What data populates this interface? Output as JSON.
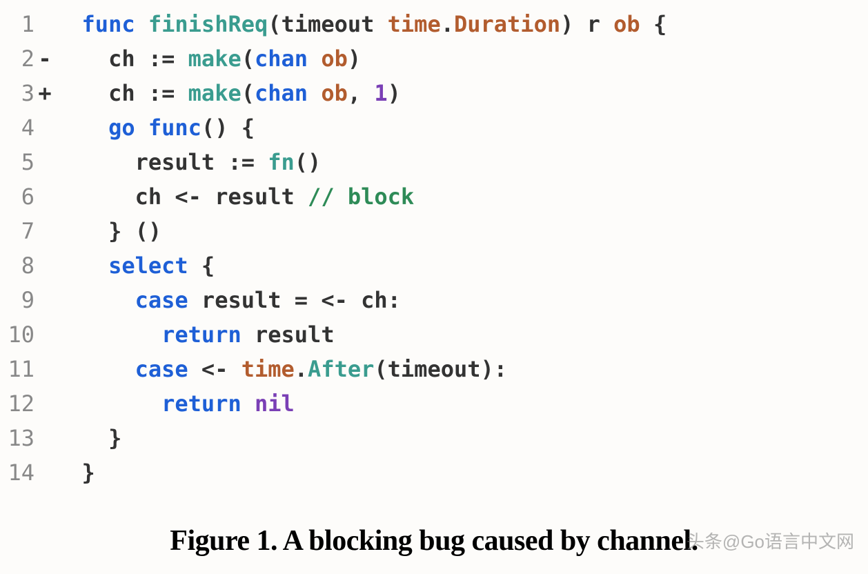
{
  "code": {
    "lines": [
      {
        "n": "1",
        "diff": "",
        "indent": 1,
        "tokens": [
          {
            "t": "func ",
            "c": "kw"
          },
          {
            "t": "finishReq",
            "c": "fn"
          },
          {
            "t": "(",
            "c": "punc"
          },
          {
            "t": "timeout ",
            "c": "id"
          },
          {
            "t": "time",
            "c": "ty"
          },
          {
            "t": ".",
            "c": "punc"
          },
          {
            "t": "Duration",
            "c": "ty"
          },
          {
            "t": ") ",
            "c": "punc"
          },
          {
            "t": "r ",
            "c": "id"
          },
          {
            "t": "ob ",
            "c": "ty"
          },
          {
            "t": "{",
            "c": "punc"
          }
        ]
      },
      {
        "n": "2",
        "diff": "-",
        "indent": 2,
        "tokens": [
          {
            "t": "ch ",
            "c": "id"
          },
          {
            "t": ":= ",
            "c": "punc"
          },
          {
            "t": "make",
            "c": "fn"
          },
          {
            "t": "(",
            "c": "punc"
          },
          {
            "t": "chan ",
            "c": "kw"
          },
          {
            "t": "ob",
            "c": "ty"
          },
          {
            "t": ")",
            "c": "punc"
          }
        ]
      },
      {
        "n": "3",
        "diff": "+",
        "indent": 2,
        "tokens": [
          {
            "t": "ch ",
            "c": "id"
          },
          {
            "t": ":= ",
            "c": "punc"
          },
          {
            "t": "make",
            "c": "fn"
          },
          {
            "t": "(",
            "c": "punc"
          },
          {
            "t": "chan ",
            "c": "kw"
          },
          {
            "t": "ob",
            "c": "ty"
          },
          {
            "t": ", ",
            "c": "punc"
          },
          {
            "t": "1",
            "c": "num"
          },
          {
            "t": ")",
            "c": "punc"
          }
        ]
      },
      {
        "n": "4",
        "diff": "",
        "indent": 2,
        "tokens": [
          {
            "t": "go ",
            "c": "kw"
          },
          {
            "t": "func",
            "c": "kw"
          },
          {
            "t": "() {",
            "c": "punc"
          }
        ]
      },
      {
        "n": "5",
        "diff": "",
        "indent": 3,
        "tokens": [
          {
            "t": "result ",
            "c": "id"
          },
          {
            "t": ":= ",
            "c": "punc"
          },
          {
            "t": "fn",
            "c": "fn"
          },
          {
            "t": "()",
            "c": "punc"
          }
        ]
      },
      {
        "n": "6",
        "diff": "",
        "indent": 3,
        "tokens": [
          {
            "t": "ch ",
            "c": "id"
          },
          {
            "t": "<- ",
            "c": "punc"
          },
          {
            "t": "result ",
            "c": "id"
          },
          {
            "t": "// block",
            "c": "cm"
          }
        ]
      },
      {
        "n": "7",
        "diff": "",
        "indent": 2,
        "tokens": [
          {
            "t": "} ()",
            "c": "punc"
          }
        ]
      },
      {
        "n": "8",
        "diff": "",
        "indent": 2,
        "tokens": [
          {
            "t": "select ",
            "c": "kw"
          },
          {
            "t": "{",
            "c": "punc"
          }
        ]
      },
      {
        "n": "9",
        "diff": "",
        "indent": 3,
        "tokens": [
          {
            "t": "case ",
            "c": "kw"
          },
          {
            "t": "result ",
            "c": "id"
          },
          {
            "t": "= <- ",
            "c": "punc"
          },
          {
            "t": "ch",
            "c": "id"
          },
          {
            "t": ":",
            "c": "punc"
          }
        ]
      },
      {
        "n": "10",
        "diff": "",
        "indent": 4,
        "tokens": [
          {
            "t": "return ",
            "c": "kw"
          },
          {
            "t": "result",
            "c": "id"
          }
        ]
      },
      {
        "n": "11",
        "diff": "",
        "indent": 3,
        "tokens": [
          {
            "t": "case ",
            "c": "kw"
          },
          {
            "t": "<- ",
            "c": "punc"
          },
          {
            "t": "time",
            "c": "ty"
          },
          {
            "t": ".",
            "c": "punc"
          },
          {
            "t": "After",
            "c": "fn"
          },
          {
            "t": "(",
            "c": "punc"
          },
          {
            "t": "timeout",
            "c": "id"
          },
          {
            "t": "):",
            "c": "punc"
          }
        ]
      },
      {
        "n": "12",
        "diff": "",
        "indent": 4,
        "tokens": [
          {
            "t": "return ",
            "c": "kw"
          },
          {
            "t": "nil",
            "c": "num"
          }
        ]
      },
      {
        "n": "13",
        "diff": "",
        "indent": 2,
        "tokens": [
          {
            "t": "}",
            "c": "punc"
          }
        ]
      },
      {
        "n": "14",
        "diff": "",
        "indent": 1,
        "tokens": [
          {
            "t": "}",
            "c": "punc"
          }
        ]
      }
    ]
  },
  "caption": "Figure 1. A blocking bug caused by channel.",
  "watermark": "头条@Go语言中文网"
}
